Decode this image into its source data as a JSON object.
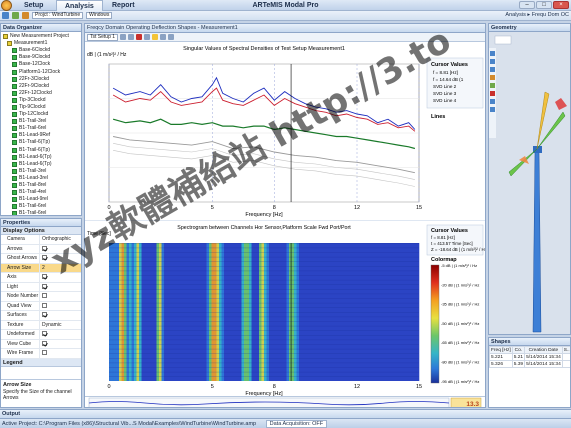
{
  "window": {
    "title": "ARTeMIS Modal Pro",
    "menu_tabs": [
      "Setup",
      "Analysis",
      "Report"
    ]
  },
  "ribbon": {
    "project_label": "Projct : WindTurbine",
    "layout_label": "Windows"
  },
  "analysis_info": "Analysis ▸ Frequ Dom OC",
  "organizer": {
    "title": "Data Organizer",
    "items": [
      "New Measurement Project",
      "Measurement1",
      "Base-6Clockd",
      "Base-9Clockd",
      "Base-12Clock",
      "Platform1-12Clock",
      "22Fr-3Clockd",
      "22Fr-9Clockd",
      "22Fr-12Clockd",
      "Tip-3Clockd",
      "Tip-9Clockd",
      "Tip-12Clockd",
      "B1-Trail-3rel",
      "B1-Trail-6rel",
      "B1-Lead-9Ref",
      "B1-Trail-6(Tp)",
      "B1-Trail-6(Tp)",
      "B1-Lead-6(Tp)",
      "B1-Lead-6(Tp)",
      "B1-Trail-3rel",
      "B1-Lead-3rel",
      "B1-Trail-8rel",
      "B1-Trail-4rel",
      "B1-Lead-9rel",
      "B1-Trail-6rel",
      "B1-Trail-6rel"
    ]
  },
  "properties": {
    "title": "Properties",
    "section": "Display Options",
    "rows": [
      {
        "k": "Camera",
        "v": "Orthographic",
        "cb": null
      },
      {
        "k": "Arrows",
        "v": "",
        "cb": true
      },
      {
        "k": "Ghost Arrows",
        "v": "",
        "cb": true
      },
      {
        "k": "Arrow Size",
        "v": "2",
        "cb": null,
        "sel": true
      },
      {
        "k": "Axis",
        "v": "",
        "cb": true
      },
      {
        "k": "Light",
        "v": "",
        "cb": true
      },
      {
        "k": "Node Number",
        "v": "",
        "cb": false
      },
      {
        "k": "Quad View",
        "v": "",
        "cb": false
      },
      {
        "k": "Surfaces",
        "v": "",
        "cb": true
      },
      {
        "k": "Texture",
        "v": "Dynamic",
        "cb": null
      },
      {
        "k": "Undeformed",
        "v": "",
        "cb": true
      },
      {
        "k": "View Cube",
        "v": "",
        "cb": true
      },
      {
        "k": "Wire Frame",
        "v": "",
        "cb": false
      }
    ],
    "legend_label": "Legend",
    "desc_title": "Arrow Size",
    "desc_text": "Specify the Size of the channel Arrows"
  },
  "main": {
    "title": "Freqcy Domain Operating Deflection Shapes - Measurement1",
    "setup_label": "Tst Setup 1"
  },
  "chart1": {
    "title": "Singular Values of Spectral Densities of Test Setup Measurement1",
    "ylabel": "dB | (1 m/s²)² / Hz",
    "xlabel": "Frequency [Hz]",
    "cursor_title": "Cursor Values",
    "cursor_lines": [
      "f = 8.81 [Hz]",
      "f = 14.64 dB (1",
      "SVD Line 2",
      "SVD Line 3",
      "SVD Line 4"
    ],
    "lines_title": "Lines"
  },
  "chart2": {
    "title": "Spectrogram between Channels Hor Sensor,Platform Scale Fwd Port/Port",
    "ylabel": "Time [Sec]",
    "xlabel": "Frequency [Hz]",
    "cursor_title": "Cursor Values",
    "cursor_lines": [
      "f = 8.81 [Hz]",
      "t = 413.57 Time [Sec]",
      "Z = -18.64 dB | (1 m/s²)² / Hz"
    ],
    "colormap_title": "Colormap",
    "colormap_ticks": [
      "-5 dB | (1 m/s²)² / Hz",
      "-20 dB | (1 m/s²)² / Hz",
      "-35 dB | (1 m/s²)² / Hz",
      "-50 dB | (1 m/s²)² / Hz",
      "-65 dB | (1 m/s²)² / Hz",
      "-80 dB | (1 m/s²)² / Hz",
      "-95 dB | (1 m/s²)² / Hz"
    ]
  },
  "strip_value": "13.3",
  "geometry": {
    "title": "Geometry"
  },
  "shapes": {
    "title": "Shapes",
    "headers": [
      "Freq [Hz]",
      "Co.",
      "Creation Date",
      "S..."
    ],
    "rows": [
      [
        "5.221",
        "5.21",
        "5/14/2014 15:34",
        ""
      ],
      [
        "5.326",
        "5.39",
        "5/14/2014 15:34",
        ""
      ]
    ]
  },
  "output": {
    "title": "Output"
  },
  "status": {
    "text": "Active Project: C:\\Program Files (x86)\\Structural Vib...S Modal\\Examples\\WindTurbine\\WindTurbine.amp",
    "acquisition": "Data Acquisition: OFF"
  },
  "watermark": "xyz軟體補給站 http://3.to",
  "chart_data": [
    {
      "type": "line",
      "title": "Singular Values of Spectral Densities of Test Setup Measurement1",
      "xlabel": "Frequency [Hz]",
      "ylabel": "dB | (1 m/s²)² / Hz",
      "xlim": [
        0,
        15
      ],
      "ylim": [
        -60,
        20
      ],
      "x_ticks": [
        0,
        5,
        8,
        12,
        15
      ],
      "y_ticks": [
        20,
        0,
        -20,
        -40,
        -60
      ],
      "series": [
        {
          "name": "SVD Line 1",
          "color": "#1f2fbf",
          "x": [
            0.2,
            0.8,
            1.5,
            2,
            2.5,
            3,
            3.5,
            4,
            4.5,
            5,
            5.2,
            5.5,
            6,
            6.5,
            7,
            7.5,
            8,
            8.5,
            9,
            9.5,
            10,
            10.5,
            11,
            11.5,
            12,
            12.5,
            13,
            13.5,
            14,
            14.5,
            14.8
          ],
          "y": [
            6,
            2,
            4,
            2,
            8,
            1,
            -2,
            0,
            1,
            8,
            12,
            3,
            0,
            -2,
            3,
            6,
            -1,
            4,
            0,
            -3,
            -5,
            -6,
            -8,
            -7,
            -9,
            -10,
            -14,
            -12,
            -16,
            -14,
            -18
          ]
        },
        {
          "name": "SVD Line 2",
          "color": "#cc2030",
          "x": [
            0.2,
            0.8,
            1.5,
            2,
            2.5,
            3,
            3.5,
            4,
            4.5,
            5,
            5.2,
            5.5,
            6,
            6.5,
            7,
            7.5,
            8,
            8.5,
            9,
            9.5,
            10,
            10.5,
            11,
            11.5,
            12,
            12.5,
            13,
            13.5,
            14,
            14.5,
            14.8
          ],
          "y": [
            2,
            -2,
            0,
            -1,
            4,
            -2,
            -4,
            -3,
            -2,
            4,
            6,
            -1,
            -3,
            -4,
            -1,
            2,
            -4,
            0,
            -3,
            -5,
            -7,
            -8,
            -10,
            -9,
            -11,
            -12,
            -15,
            -14,
            -17,
            -16,
            -19
          ]
        },
        {
          "name": "SVD Line 3",
          "color": "#1a7a2a",
          "x": [
            0.2,
            0.8,
            1.5,
            2,
            2.5,
            3,
            3.5,
            4,
            4.5,
            5,
            5.5,
            6,
            6.5,
            7,
            7.5,
            8,
            8.5,
            9,
            9.5,
            10,
            10.5,
            11,
            11.5,
            12,
            12.5,
            13,
            13.5,
            14,
            14.5,
            14.8
          ],
          "y": [
            -12,
            -14,
            -13,
            -14,
            -12,
            -15,
            -15,
            -14,
            -15,
            -14,
            -16,
            -16,
            -17,
            -16,
            -16,
            -18,
            -17,
            -18,
            -19,
            -20,
            -21,
            -22,
            -22,
            -23,
            -24,
            -25,
            -26,
            -27,
            -28,
            -29
          ]
        },
        {
          "name": "SVD Line 4",
          "color": "#9a9a9a",
          "x": [
            0.2,
            1,
            2,
            3,
            4,
            5,
            6,
            7,
            8,
            9,
            10,
            11,
            12,
            13,
            14,
            14.8
          ],
          "y": [
            -22,
            -24,
            -25,
            -26,
            -27,
            -25,
            -29,
            -28,
            -31,
            -33,
            -34,
            -36,
            -37,
            -39,
            -41,
            -43
          ]
        }
      ]
    },
    {
      "type": "heatmap",
      "title": "Spectrogram between Channels Hor Sensor,Platform Scale Fwd Port/Port",
      "xlabel": "Frequency [Hz]",
      "ylabel": "Time [Sec]",
      "xlim": [
        0,
        15
      ],
      "x_ticks": [
        0,
        5,
        8,
        12,
        15
      ],
      "colorbar": {
        "min_db": -95,
        "max_db": -5,
        "ticks_db": [
          -5,
          -20,
          -35,
          -50,
          -65,
          -80,
          -95
        ]
      },
      "hot_frequencies_hz": [
        0.6,
        1.3,
        2.4,
        4.9,
        5.2,
        6.6,
        7.4,
        8.8
      ]
    }
  ]
}
